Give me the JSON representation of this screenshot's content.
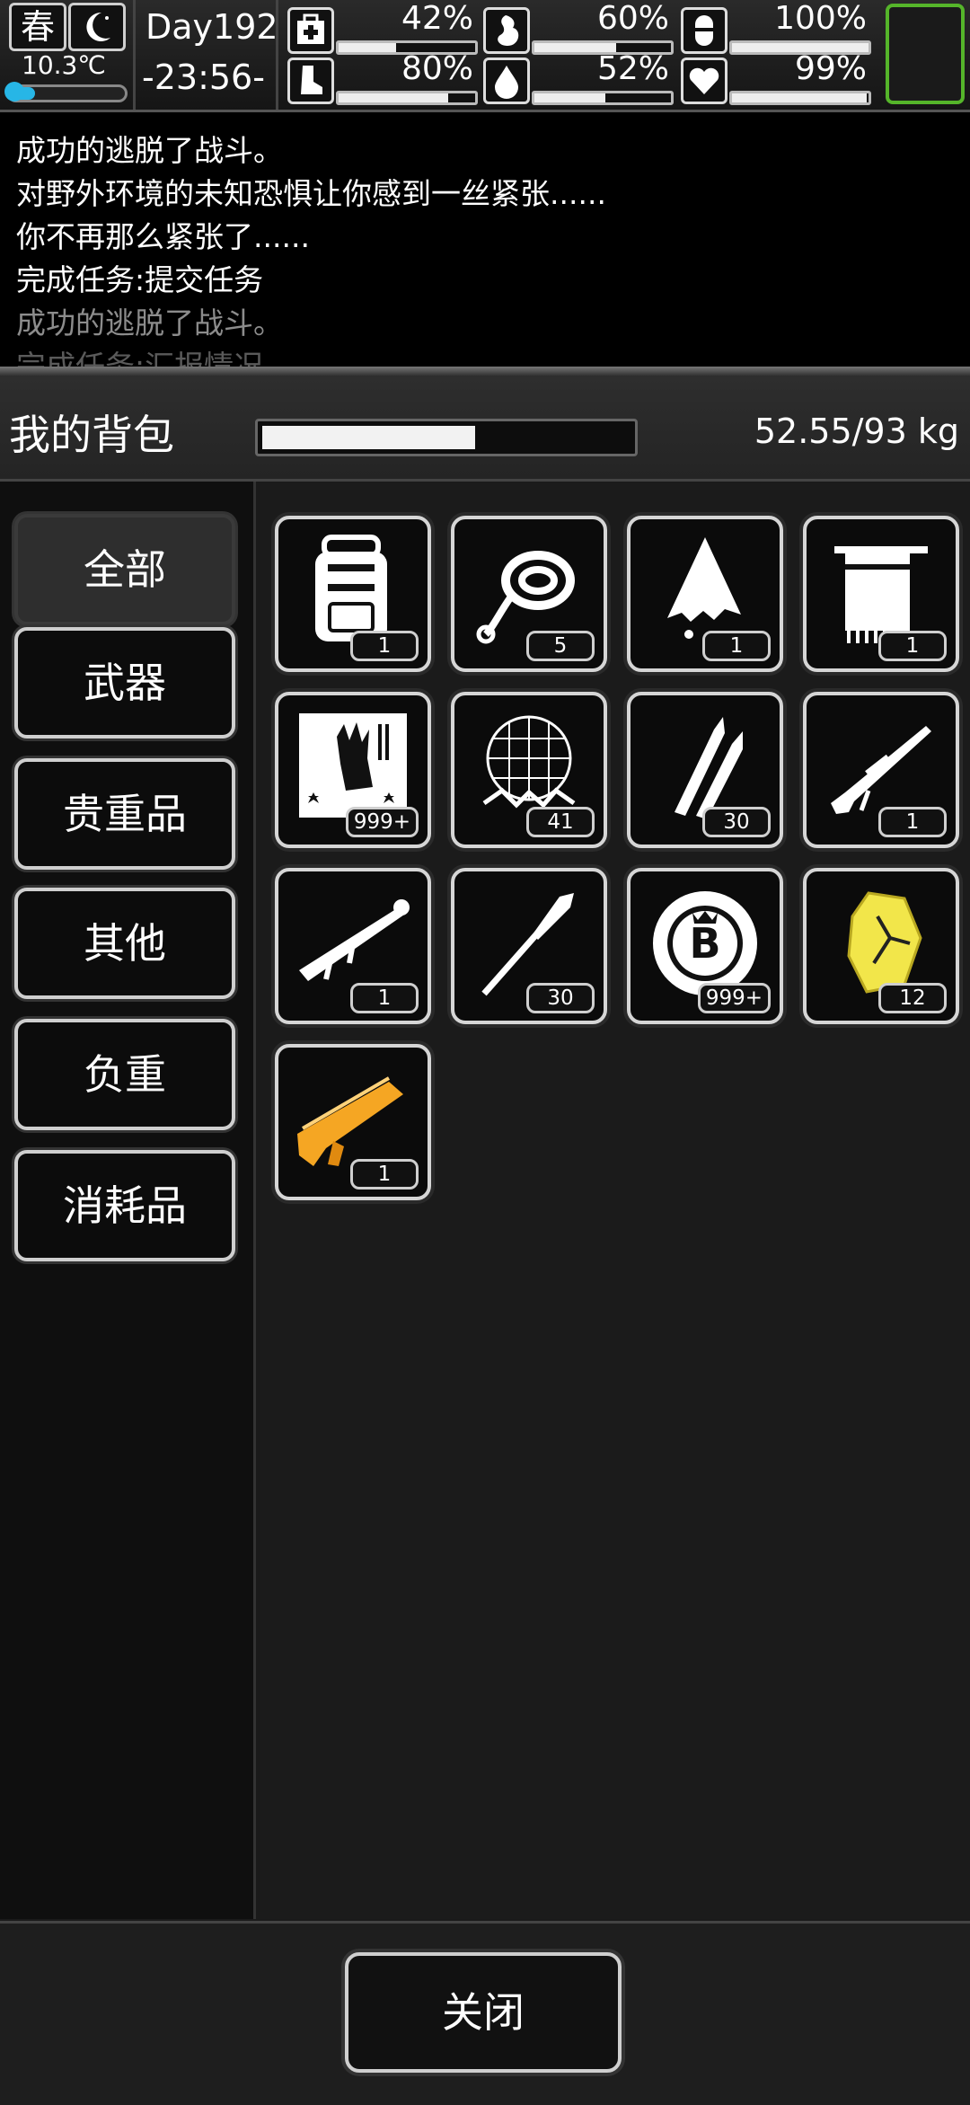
{
  "status": {
    "season": "春",
    "temperature": "10.3℃",
    "temperature_level": 0.22,
    "day": "Day192",
    "time": "-23:56-",
    "stats": [
      {
        "icon": "medkit-icon",
        "percent": "42%",
        "level": 0.42
      },
      {
        "icon": "stomach-icon",
        "percent": "60%",
        "level": 0.6
      },
      {
        "icon": "pill-icon",
        "percent": "100%",
        "level": 1.0
      },
      {
        "icon": "foot-icon",
        "percent": "80%",
        "level": 0.8
      },
      {
        "icon": "water-drop-icon",
        "percent": "52%",
        "level": 0.52
      },
      {
        "icon": "heart-icon",
        "percent": "99%",
        "level": 0.99
      }
    ]
  },
  "log": [
    "成功的逃脱了战斗。",
    "对野外环境的未知恐惧让你感到一丝紧张......",
    "你不再那么紧张了......",
    "完成任务:提交任务",
    "成功的逃脱了战斗。",
    "完成任务:汇报情况"
  ],
  "backpack": {
    "title": "我的背包",
    "weight": "52.55/93 kg",
    "weight_ratio": 0.565
  },
  "categories": [
    "全部",
    "武器",
    "贵重品",
    "其他",
    "负重",
    "消耗品"
  ],
  "items": [
    {
      "icon": "backpack-icon",
      "count": "1"
    },
    {
      "icon": "rope-icon",
      "count": "5"
    },
    {
      "icon": "torn-cloth-icon",
      "count": "1"
    },
    {
      "icon": "towel-icon",
      "count": "1"
    },
    {
      "icon": "zombie-poster-icon",
      "count": "999+"
    },
    {
      "icon": "net-trap-icon",
      "count": "41"
    },
    {
      "icon": "bullets-icon",
      "count": "30"
    },
    {
      "icon": "sniper-rifle-icon",
      "count": "1"
    },
    {
      "icon": "rocket-launcher-icon",
      "count": "1"
    },
    {
      "icon": "rocket-ammo-icon",
      "count": "30"
    },
    {
      "icon": "coin-icon",
      "count": "999+"
    },
    {
      "icon": "gold-crystal-icon",
      "count": "12"
    },
    {
      "icon": "golden-gun-icon",
      "count": "1"
    }
  ],
  "colors": {
    "accent_green": "#55b52a",
    "temp_blue": "#27b6e6",
    "gold": "#f5a623",
    "crystal_yellow": "#f2e64a"
  },
  "close_label": "关闭"
}
